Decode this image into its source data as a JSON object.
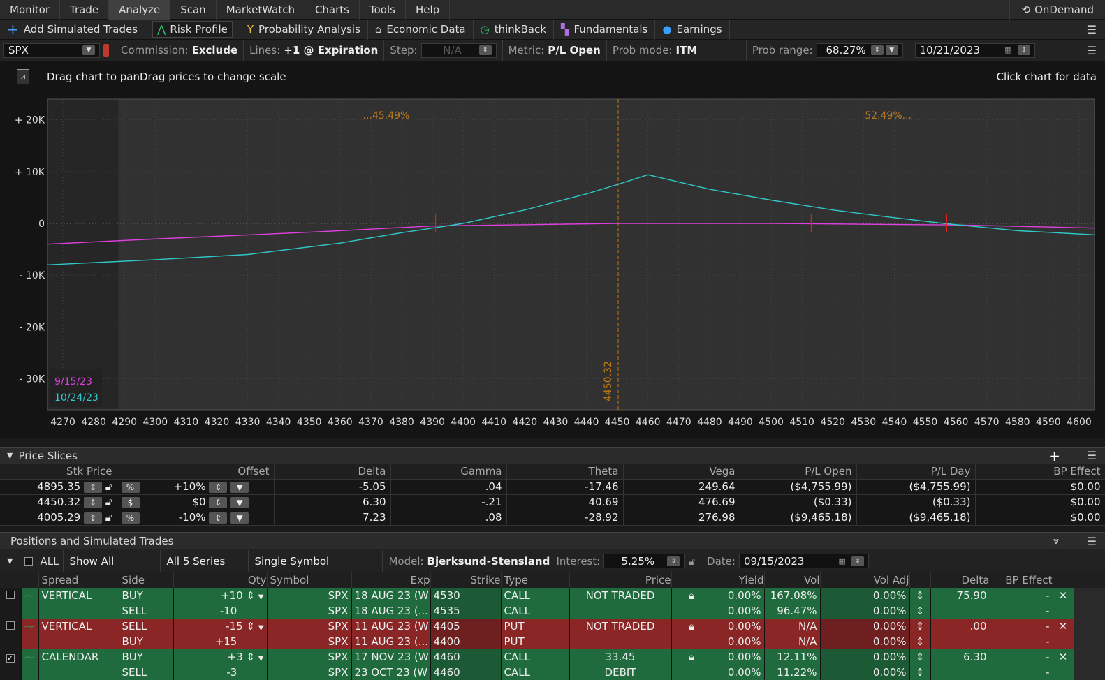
{
  "menu": {
    "items": [
      "Monitor",
      "Trade",
      "Analyze",
      "Scan",
      "MarketWatch",
      "Charts",
      "Tools",
      "Help"
    ],
    "active": "Analyze",
    "ondemand": "OnDemand"
  },
  "toolbar": {
    "add_sim": "Add Simulated Trades",
    "risk_profile": "Risk Profile",
    "prob_analysis": "Probability Analysis",
    "economic_data": "Economic Data",
    "thinkback": "thinkBack",
    "fundamentals": "Fundamentals",
    "earnings": "Earnings"
  },
  "controls": {
    "symbol": "SPX",
    "commission_label": "Commission:",
    "commission_value": "Exclude",
    "lines_label": "Lines:",
    "lines_value": "+1 @ Expiration",
    "step_label": "Step:",
    "step_value": "N/A",
    "metric_label": "Metric:",
    "metric_value": "P/L Open",
    "probmode_label": "Prob mode:",
    "probmode_value": "ITM",
    "probrange_label": "Prob range:",
    "probrange_value": "68.27%",
    "date": "10/21/2023"
  },
  "chart_header": {
    "hint": "Drag chart to panDrag prices to change scale",
    "click_hint": "Click chart for data"
  },
  "chart_data": {
    "type": "line",
    "x_ticks": [
      "4270",
      "4280",
      "4290",
      "4300",
      "4310",
      "4320",
      "4330",
      "4340",
      "4350",
      "4360",
      "4370",
      "4380",
      "4390",
      "4400",
      "4410",
      "4420",
      "4430",
      "4440",
      "4450",
      "4460",
      "4470",
      "4480",
      "4490",
      "4500",
      "4510",
      "4520",
      "4530",
      "4540",
      "4550",
      "4560",
      "4570",
      "4580",
      "4590",
      "4600"
    ],
    "y_ticks": [
      "+ 20K",
      "+ 10K",
      "0",
      "- 10K",
      "- 20K",
      "- 30K"
    ],
    "y_values": [
      20000,
      10000,
      0,
      -10000,
      -20000,
      -30000
    ],
    "xlim": [
      4265,
      4605
    ],
    "ylim": [
      -36000,
      24000
    ],
    "current_price": "4450.32",
    "prob_left": "...45.49%",
    "prob_right": "52.49%...",
    "series": [
      {
        "name": "9/15/23",
        "color": "#e040e0",
        "points": [
          [
            4265,
            -4000
          ],
          [
            4300,
            -3000
          ],
          [
            4350,
            -1700
          ],
          [
            4390,
            -500
          ],
          [
            4450,
            0
          ],
          [
            4500,
            0
          ],
          [
            4560,
            -300
          ],
          [
            4605,
            -900
          ]
        ]
      },
      {
        "name": "10/24/23",
        "color": "#30c8c8",
        "points": [
          [
            4265,
            -8000
          ],
          [
            4300,
            -7000
          ],
          [
            4330,
            -6000
          ],
          [
            4360,
            -3800
          ],
          [
            4380,
            -1800
          ],
          [
            4400,
            0
          ],
          [
            4420,
            2600
          ],
          [
            4440,
            5700
          ],
          [
            4450,
            7500
          ],
          [
            4460,
            9400
          ],
          [
            4480,
            6600
          ],
          [
            4500,
            4500
          ],
          [
            4520,
            2600
          ],
          [
            4540,
            1100
          ],
          [
            4556,
            0
          ],
          [
            4580,
            -1400
          ],
          [
            4605,
            -2200
          ]
        ]
      }
    ],
    "markers": [
      4391,
      4513,
      4557
    ]
  },
  "slices": {
    "title": "Price Slices",
    "columns": [
      "Stk Price",
      "Offset",
      "Delta",
      "Gamma",
      "Theta",
      "Vega",
      "P/L Open",
      "P/L Day",
      "BP Effect"
    ],
    "rows": [
      {
        "price": "4895.35",
        "unit": "%",
        "offset": "+10%",
        "delta": "-5.05",
        "gamma": ".04",
        "theta": "-17.46",
        "vega": "249.64",
        "plopen": "($4,755.99)",
        "plday": "($4,755.99)",
        "bp": "$0.00"
      },
      {
        "price": "4450.32",
        "unit": "$",
        "offset": "$0",
        "delta": "6.30",
        "gamma": "-.21",
        "theta": "40.69",
        "vega": "476.69",
        "plopen": "($0.33)",
        "plday": "($0.33)",
        "bp": "$0.00"
      },
      {
        "price": "4005.29",
        "unit": "%",
        "offset": "-10%",
        "delta": "7.23",
        "gamma": ".08",
        "theta": "-28.92",
        "vega": "276.98",
        "plopen": "($9,465.18)",
        "plday": "($9,465.18)",
        "bp": "$0.00"
      }
    ]
  },
  "positions": {
    "title": "Positions and Simulated Trades",
    "all": "ALL",
    "show_all": "Show All",
    "series": "All 5 Series",
    "single_symbol": "Single Symbol",
    "model_label": "Model:",
    "model_value": "Bjerksund-Stensland",
    "interest_label": "Interest:",
    "interest_value": "5.25%",
    "date_label": "Date:",
    "date_value": "09/15/2023",
    "columns": [
      "Spread",
      "Side",
      "Qty",
      "Symbol",
      "Exp",
      "Strike",
      "Type",
      "Price",
      "Yield",
      "Vol",
      "Vol Adj",
      "Delta",
      "BP Effect"
    ],
    "rows": [
      {
        "color": "green",
        "check": "",
        "spread": "VERTICAL",
        "side": "BUY",
        "qty": "+10",
        "symbol": "SPX",
        "exp": "18 AUG 23 (W",
        "strike": "4530",
        "type": "CALL",
        "price": "NOT TRADED",
        "yield": "0.00%",
        "vol": "167.08%",
        "voladj": "0.00%",
        "delta": "75.90",
        "bp": "-",
        "x": "✕"
      },
      {
        "color": "green",
        "check": "",
        "spread": "",
        "side": "SELL",
        "qty": "-10",
        "symbol": "SPX",
        "exp": "18 AUG 23 (...",
        "strike": "4535",
        "type": "CALL",
        "price": "",
        "yield": "0.00%",
        "vol": "96.47%",
        "voladj": "0.00%",
        "delta": "",
        "bp": "-",
        "x": ""
      },
      {
        "color": "red",
        "check": "",
        "spread": "VERTICAL",
        "side": "SELL",
        "qty": "-15",
        "symbol": "SPX",
        "exp": "11 AUG 23 (W",
        "strike": "4405",
        "type": "PUT",
        "price": "NOT TRADED",
        "yield": "0.00%",
        "vol": "N/A",
        "voladj": "0.00%",
        "delta": ".00",
        "bp": "-",
        "x": "✕"
      },
      {
        "color": "red",
        "check": "",
        "spread": "",
        "side": "BUY",
        "qty": "+15",
        "symbol": "SPX",
        "exp": "11 AUG 23 (...",
        "strike": "4400",
        "type": "PUT",
        "price": "",
        "yield": "0.00%",
        "vol": "N/A",
        "voladj": "0.00%",
        "delta": "",
        "bp": "-",
        "x": ""
      },
      {
        "color": "green",
        "check": "✓",
        "spread": "CALENDAR",
        "side": "BUY",
        "qty": "+3",
        "symbol": "SPX",
        "exp": "17 NOV 23 (W",
        "strike": "4460",
        "type": "CALL",
        "price": "33.45",
        "yield": "0.00%",
        "vol": "12.11%",
        "voladj": "0.00%",
        "delta": "6.30",
        "bp": "-",
        "x": "✕"
      },
      {
        "color": "green",
        "check": "",
        "spread": "",
        "side": "SELL",
        "qty": "-3",
        "symbol": "SPX",
        "exp": "23 OCT 23 (W",
        "strike": "4460",
        "type": "CALL",
        "price": "DEBIT",
        "yield": "0.00%",
        "vol": "11.22%",
        "voladj": "0.00%",
        "delta": "",
        "bp": "-",
        "x": ""
      }
    ]
  }
}
